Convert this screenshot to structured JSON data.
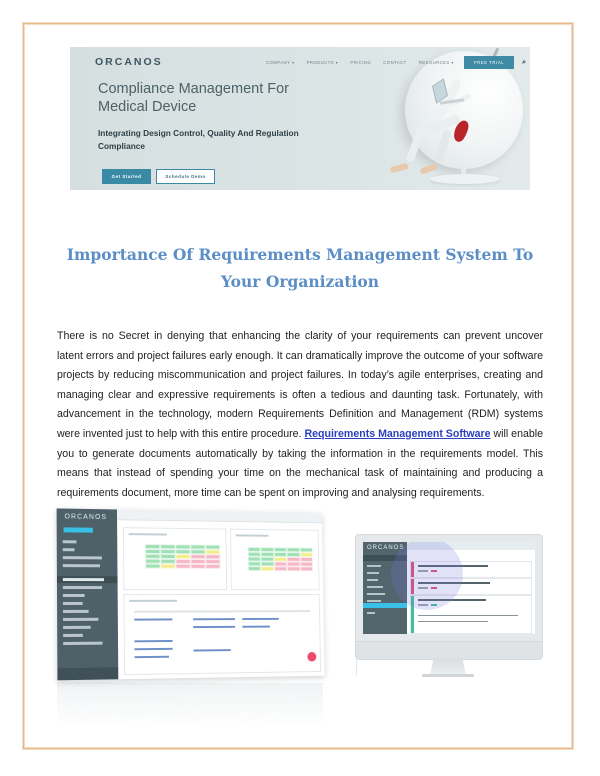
{
  "hero": {
    "logo": "ORCANOS",
    "nav": [
      "COMPANY ▾",
      "PRODUCTS ▾",
      "PRICING",
      "CONTACT",
      "RESOURCES ▾"
    ],
    "cta_trial": "FREE TRIAL",
    "search_icon": "⌕",
    "headline": "Compliance Management For Medical Device",
    "subheadline": "Integrating Design Control, Quality And Regulation Compliance",
    "primary_button": "Get Started",
    "secondary_button": "Schedule Demo",
    "accent_color": "#3a8aa6"
  },
  "article": {
    "title": "Importance Of Requirements Management System To Your Organization",
    "title_color": "#5b8ec6",
    "paragraph_before_link": "There is no Secret in denying that enhancing the clarity of your requirements can prevent uncover latent errors and project failures early enough. It can dramatically improve the outcome of your software projects by reducing miscommunication and project failures. In today’s agile enterprises, creating and managing clear and expressive requirements is often a tedious and daunting task. Fortunately, with advancement in the technology, modern Requirements Definition and Management (RDM) systems were invented just to help with this entire procedure. ",
    "link_text": "Requirements Management Software",
    "paragraph_after_link": " will enable you to generate documents automatically by taking the information in the requirements model. This means that instead of spending your time on the mechanical task of maintaining and producing a requirements document, more time can be spent on improving and analysing requirements."
  },
  "dashboard_screenshot": {
    "logo": "ORCANOS",
    "risk_matrix_colors": {
      "low": "#9fe0b4",
      "medium": "#f3ec8a",
      "high": "#f5b6c6"
    }
  },
  "imac_screenshot": {
    "logo": "ORCANOS",
    "apple_icon": ""
  }
}
